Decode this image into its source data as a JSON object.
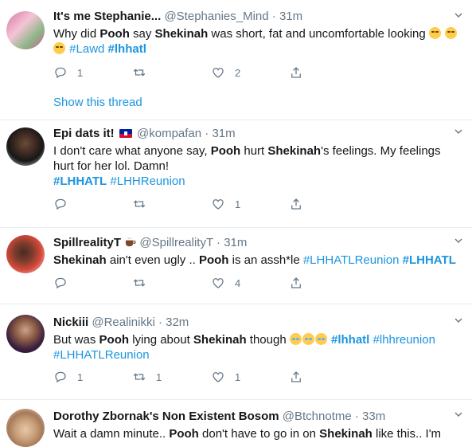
{
  "tweets": [
    {
      "name": "It's me Stephanie...",
      "handle": "@Stephanies_Mind",
      "dot": "·",
      "time": "31m",
      "text_parts": [
        "Why did ",
        "Pooh",
        " say ",
        "Shekinah",
        " was short, fat and uncomfortable looking "
      ],
      "tags": [
        "#Lawd",
        "#lhhatl"
      ],
      "reply": "1",
      "retweet": "",
      "like": "2",
      "show_thread": "Show this thread"
    },
    {
      "name": "Epi dats it!",
      "handle": "@kompafan",
      "dot": "·",
      "time": "31m",
      "text_parts": [
        "I don't care what anyone say, ",
        "Pooh",
        " hurt ",
        "Shekinah",
        "'s feelings.  My feelings hurt for her lol.  Damn!"
      ],
      "tags": [
        "#LHHATL",
        "#LHHReunion"
      ],
      "reply": "",
      "retweet": "",
      "like": "1"
    },
    {
      "name": "SpillrealityT",
      "handle": "@SpillrealityT",
      "dot": "·",
      "time": "31m",
      "text_parts": [
        "Shekinah",
        " ain't even ugly .. ",
        "Pooh",
        " is an assh*le "
      ],
      "tags": [
        "#LHHATLReunion",
        "#LHHATL"
      ],
      "reply": "",
      "retweet": "",
      "like": "4"
    },
    {
      "name": "Nickiii",
      "handle": "@Realinikki",
      "dot": "·",
      "time": "32m",
      "text_parts": [
        "But was ",
        "Pooh",
        " lying about ",
        "Shekinah",
        " though "
      ],
      "tags": [
        "#lhhatl",
        "#lhhreunion",
        "#LHHATLReunion"
      ],
      "reply": "1",
      "retweet": "1",
      "like": "1"
    },
    {
      "name": "Dorothy Zbornak's Non Existent Bosom",
      "handle": "@Btchnotme",
      "dot": "·",
      "time": "33m",
      "text_parts": [
        "Wait a damn minute.. ",
        "Pooh",
        " don't have to go in on ",
        "Shekinah",
        " like this.. I'm"
      ]
    }
  ],
  "colors": {
    "link": "#1b95e0",
    "muted": "#657786",
    "text": "#14171a",
    "divider": "#e6ecf0"
  },
  "icons": [
    "reply-icon",
    "retweet-icon",
    "like-icon",
    "share-icon",
    "chevron-down-icon",
    "haiti-flag-icon",
    "tea-cup-icon",
    "grimacing-face-icon",
    "tears-of-joy-icon"
  ]
}
